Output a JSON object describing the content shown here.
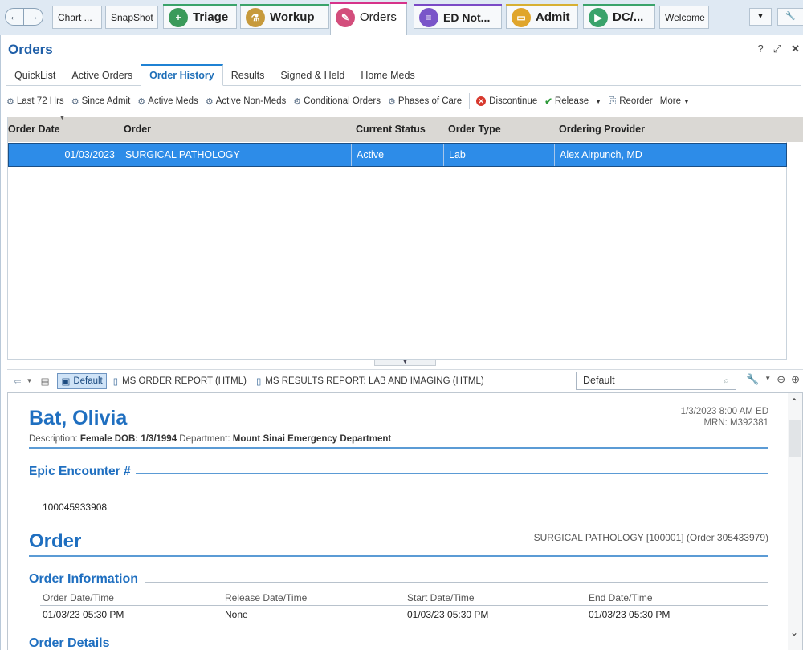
{
  "nav": {
    "back": "←",
    "fwd": "→"
  },
  "tabs": [
    {
      "label": "Chart ...",
      "accent": ""
    },
    {
      "label": "SnapShot",
      "accent": ""
    },
    {
      "label": "Triage",
      "accent": "#3aa36b",
      "icon_color": "#3a9a5a"
    },
    {
      "label": "Workup",
      "accent": "#3aa36b",
      "icon_color": "#c79a3c"
    },
    {
      "label": "Orders",
      "accent": "#d6338a",
      "icon_color": "#d34e7c"
    },
    {
      "label": "ED Not...",
      "accent": "#7a4ac6",
      "icon_color": "#7a55c9"
    },
    {
      "label": "Admit",
      "accent": "#d7b033",
      "icon_color": "#e0a52b"
    },
    {
      "label": "DC/...",
      "accent": "#3aa36b",
      "icon_color": "#3aa36b"
    },
    {
      "label": "Welcome",
      "accent": ""
    }
  ],
  "activity": {
    "title": "Orders",
    "subtabs": [
      "QuickList",
      "Active Orders",
      "Order History",
      "Results",
      "Signed & Held",
      "Home Meds"
    ],
    "active_subtab": "Order History",
    "filters": [
      "Last 72 Hrs",
      "Since Admit",
      "Active Meds",
      "Active Non-Meds",
      "Conditional Orders",
      "Phases of Care"
    ],
    "actions": {
      "discontinue": "Discontinue",
      "release": "Release",
      "reorder": "Reorder",
      "more": "More"
    }
  },
  "table": {
    "columns": [
      "Order Date",
      "Order",
      "Current Status",
      "Order Type",
      "Ordering Provider"
    ],
    "rows": [
      {
        "date": "01/03/2023",
        "order": "SURGICAL PATHOLOGY",
        "status": "Active",
        "type": "Lab",
        "provider": "Alex Airpunch, MD"
      }
    ]
  },
  "report_toolbar": {
    "default_btn": "Default",
    "reports": [
      "MS ORDER REPORT (HTML)",
      "MS RESULTS REPORT: LAB AND IMAGING (HTML)"
    ],
    "search_value": "Default"
  },
  "report": {
    "patient_name": "Bat, Olivia",
    "desc_label": "Description:",
    "desc_value": "Female DOB: 1/3/1994",
    "dept_label": "Department:",
    "dept_value": "Mount Sinai Emergency Department",
    "datetime": "1/3/2023  8:00 AM  ED",
    "mrn": "MRN: M392381",
    "encounter_heading": "Epic Encounter #",
    "encounter_number": "100045933908",
    "order_heading": "Order",
    "order_summary": "SURGICAL PATHOLOGY [100001] (Order 305433979)",
    "order_info_heading": "Order Information",
    "info_labels": [
      "Order Date/Time",
      "Release Date/Time",
      "Start Date/Time",
      "End Date/Time"
    ],
    "info_values": [
      "01/03/23 05:30 PM",
      "None",
      "01/03/23 05:30 PM",
      "01/03/23 05:30 PM"
    ],
    "details_heading": "Order Details"
  }
}
